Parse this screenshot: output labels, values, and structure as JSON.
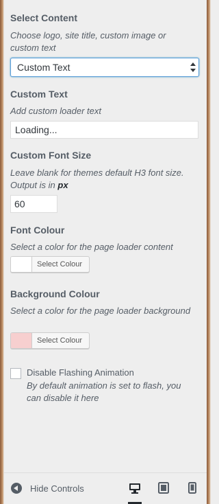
{
  "select_content": {
    "title": "Select Content",
    "description": "Choose logo, site title, custom image or custom text",
    "selected": "Custom Text"
  },
  "custom_text": {
    "title": "Custom Text",
    "description": "Add custom loader text",
    "value": "Loading..."
  },
  "custom_font_size": {
    "title": "Custom Font Size",
    "description_a": "Leave blank for themes default H3 font size. Output is in",
    "description_unit": "px",
    "value": "60"
  },
  "font_colour": {
    "title": "Font Colour",
    "description": "Select a color for the page loader content",
    "button_label": "Select Colour",
    "swatch_color": "#ffffff"
  },
  "background_colour": {
    "title": "Background Colour",
    "description": "Select a color for the page loader background",
    "button_label": "Select Colour",
    "swatch_color": "#f7cfcf"
  },
  "disable_flashing": {
    "label": "Disable Flashing Animation",
    "description": "By default animation is set to flash, you can disable it here",
    "checked": false
  },
  "footer": {
    "hide_controls_label": "Hide Controls",
    "devices": [
      "desktop-icon",
      "tablet-icon",
      "mobile-icon"
    ],
    "active_device": "desktop"
  }
}
